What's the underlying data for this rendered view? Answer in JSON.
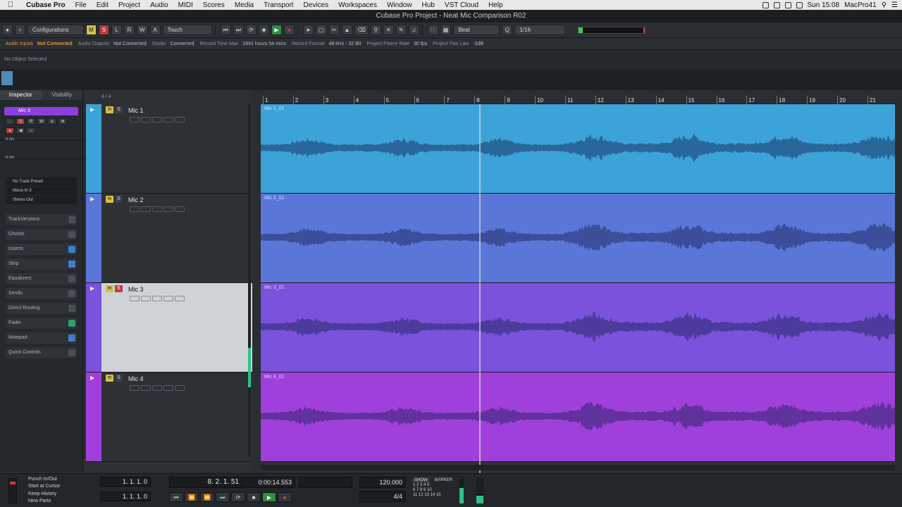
{
  "menubar": {
    "items": [
      "Cubase Pro",
      "File",
      "Edit",
      "Project",
      "Audio",
      "MIDI",
      "Scores",
      "Media",
      "Transport",
      "Devices",
      "Workspaces",
      "Window",
      "Hub",
      "VST Cloud",
      "Help"
    ],
    "clock": "Sun 15:08",
    "user": "MacPro41"
  },
  "window_title": "Cubase Pro Project - Neat Mic Comparison R02",
  "toolbar": {
    "configurations": "Configurations",
    "touch": "Touch",
    "m": "M",
    "s": "S",
    "l": "L",
    "r": "R",
    "w": "W",
    "a": "A",
    "grid_type": "Beat",
    "quantize": "1/16"
  },
  "status": {
    "audio_inputs_label": "Audio Inputs",
    "audio_inputs_value": "Not Connected",
    "audio_outputs_label": "Audio Outputs",
    "audio_outputs_value": "Not Connected",
    "studio_label": "Studio",
    "studio_value": "Connected",
    "record_time_label": "Record Time Max",
    "record_time_value": "2491 hours 54 mins",
    "record_format_label": "Record Format",
    "record_format_value": "48 kHz - 32 Bit",
    "frame_rate_label": "Project Frame Rate",
    "frame_rate_value": "30 fps",
    "pan_law_label": "Project Pan Law",
    "pan_law_value": "-3dB"
  },
  "info_line": "No Object Selected",
  "inspector": {
    "tab_inspector": "Inspector",
    "tab_visibility": "Visibility",
    "track_name": "Mic 3",
    "val1": "0.00",
    "val2": "0.00",
    "preset": "No Track Preset",
    "input": "Mono In 3",
    "output": "Stereo Out",
    "sections": [
      "TrackVersions",
      "Chords",
      "Inserts",
      "Strip",
      "Equalizers",
      "Sends",
      "Direct Routing",
      "Fader",
      "Notepad",
      "Quick Controls"
    ]
  },
  "tracklist": {
    "count": "4 / 4",
    "tracks": [
      {
        "name": "Mic 1",
        "clip": "Mic 1_01",
        "color": "#3ba3d8"
      },
      {
        "name": "Mic 2",
        "clip": "Mic 2_01",
        "color": "#5a76d8"
      },
      {
        "name": "Mic 3",
        "clip": "Mic 3_01",
        "color": "#7a52dc"
      },
      {
        "name": "Mic 4",
        "clip": "Mic 4_01",
        "color": "#a040dc"
      }
    ]
  },
  "ruler": {
    "bars": [
      "1",
      "2",
      "3",
      "4",
      "5",
      "6",
      "7",
      "8",
      "9",
      "10",
      "11",
      "12",
      "13",
      "14",
      "15",
      "16",
      "17",
      "18",
      "19",
      "20",
      "21"
    ]
  },
  "transport": {
    "punch": "Punch In/Out",
    "start_at_cursor": "Start at Cursor",
    "keep_history": "Keep History",
    "new_parts": "New Parts",
    "left_locator": "1. 1. 1. 0",
    "right_locator": "1. 1. 1. 0",
    "position": "8. 2. 1. 51",
    "time": "0:00:14.553",
    "tempo": "120.000",
    "signature": "4/4",
    "show": "SHOW",
    "marker": "MARKER",
    "marker_grid": [
      "1 2 3 4 5",
      "6 7 8 9 10",
      "11 12 13 14 15"
    ]
  }
}
